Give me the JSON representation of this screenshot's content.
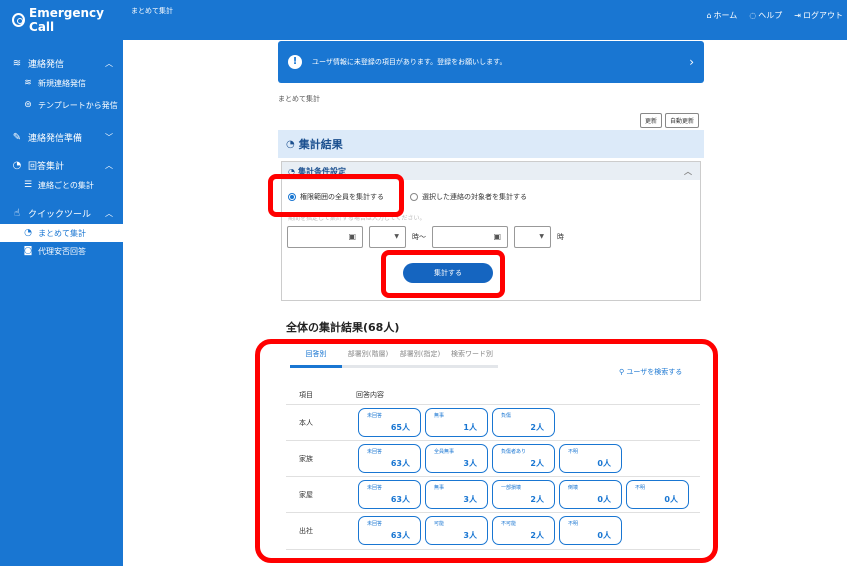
{
  "app": {
    "logo_text": "Emergency Call"
  },
  "topbar": {
    "breadcrumb": "まとめて集計",
    "home": "ホーム",
    "help": "ヘルプ",
    "logout": "ログアウト"
  },
  "sidebar": {
    "groups": [
      {
        "label": "連絡発信",
        "items": [
          {
            "label": "新規連絡発信"
          },
          {
            "label": "テンプレートから発信"
          }
        ]
      },
      {
        "label": "連絡発信準備",
        "items": []
      },
      {
        "label": "回答集計",
        "items": [
          {
            "label": "連絡ごとの集計"
          }
        ]
      },
      {
        "label": "クイックツール",
        "items": [
          {
            "label": "まとめて集計"
          },
          {
            "label": "代理安否回答"
          }
        ]
      }
    ]
  },
  "banner": {
    "message": "ユーザ情報に未登録の項目があります。登録をお願いします。"
  },
  "page": {
    "breadcrumb": "まとめて集計",
    "update_btn": "更新",
    "auto_update_btn": "自動更新"
  },
  "summary": {
    "title": "集計結果",
    "condition": {
      "title": "集計条件設定",
      "option_all": "権限範囲の全員を集計する",
      "option_selected": "選択した連絡の対象者を集計する",
      "hint": "期間を指定して集計する場合は入力してください。",
      "time_from_suffix": "時～",
      "time_to_suffix": "時"
    },
    "aggregate_btn": "集計する"
  },
  "results": {
    "title": "全体の集計結果(68人)",
    "tabs": [
      "回答別",
      "部署別(階層)",
      "部署別(指定)",
      "検索ワード別"
    ],
    "active_tab": 0,
    "search_user": "ユーザを検索する",
    "col_item": "項目",
    "col_answer": "回答内容",
    "rows": [
      {
        "label": "本人",
        "answers": [
          {
            "label": "未回答",
            "count": "65人"
          },
          {
            "label": "無事",
            "count": "1人"
          },
          {
            "label": "負傷",
            "count": "2人"
          }
        ]
      },
      {
        "label": "家族",
        "answers": [
          {
            "label": "未回答",
            "count": "63人"
          },
          {
            "label": "全員無事",
            "count": "3人"
          },
          {
            "label": "負傷者あり",
            "count": "2人"
          },
          {
            "label": "不明",
            "count": "0人"
          }
        ]
      },
      {
        "label": "家屋",
        "answers": [
          {
            "label": "未回答",
            "count": "63人"
          },
          {
            "label": "無事",
            "count": "3人"
          },
          {
            "label": "一部損壊",
            "count": "2人"
          },
          {
            "label": "倒壊",
            "count": "0人"
          },
          {
            "label": "不明",
            "count": "0人"
          }
        ]
      },
      {
        "label": "出社",
        "answers": [
          {
            "label": "未回答",
            "count": "63人"
          },
          {
            "label": "可能",
            "count": "3人"
          },
          {
            "label": "不可能",
            "count": "2人"
          },
          {
            "label": "不明",
            "count": "0人"
          }
        ]
      }
    ]
  },
  "colors": {
    "primary": "#1976d2",
    "annotation": "#ff0000",
    "section_bg": "#dceaf9"
  }
}
